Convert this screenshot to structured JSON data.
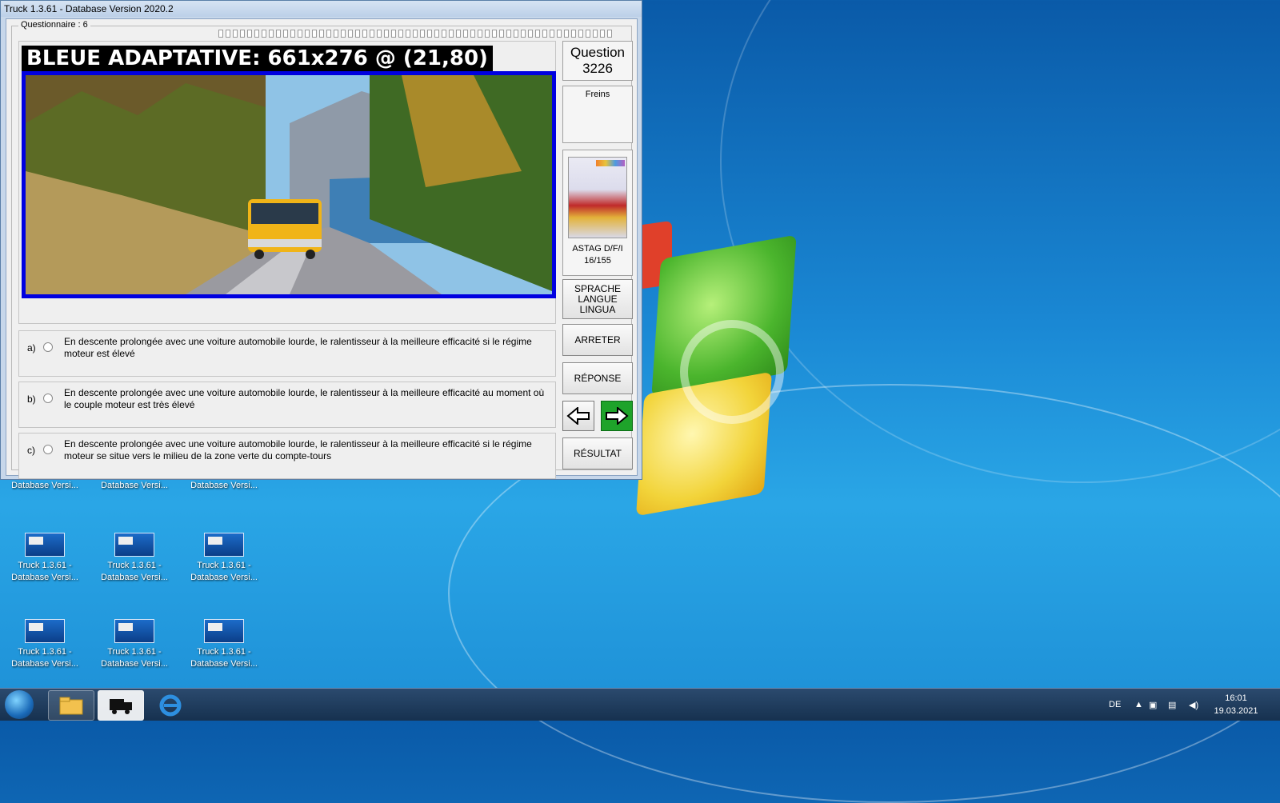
{
  "window": {
    "title": "Truck 1.3.61 - Database Version 2020.2"
  },
  "questionnaire": {
    "label": "Questionnaire : 6"
  },
  "image": {
    "caption": "BLEUE ADAPTATIVE: 661x276 @ (21,80)"
  },
  "question": {
    "label": "Question",
    "number": "3226",
    "category": "Freins"
  },
  "book": {
    "title": "ASTAG D/F/I",
    "pages": "16/155"
  },
  "buttons": {
    "language": [
      "SPRACHE",
      "LANGUE",
      "LINGUA"
    ],
    "stop": "ARRETER",
    "answer": "RÉPONSE",
    "result": "RÉSULTAT",
    "prev_icon": "arrow-left-icon",
    "next_icon": "arrow-right-icon"
  },
  "answers": [
    {
      "letter": "a)",
      "text": "En descente prolongée avec une voiture automobile lourde, le ralentisseur à la meilleure efficacité si le régime moteur est élevé"
    },
    {
      "letter": "b)",
      "text": "En descente prolongée avec une voiture automobile lourde, le ralentisseur à la meilleure efficacité au moment où le couple moteur est très élevé"
    },
    {
      "letter": "c)",
      "text": "En descente prolongée avec une voiture automobile lourde, le ralentisseur à la meilleure efficacité si le régime moteur se situe vers le milieu de la zone verte du compte-tours"
    }
  ],
  "desktop_icons": [
    {
      "line1": "",
      "line2": "Database Versi..."
    },
    {
      "line1": "",
      "line2": "Database Versi..."
    },
    {
      "line1": "",
      "line2": "Database Versi..."
    },
    {
      "line1": "Truck 1.3.61 -",
      "line2": "Database Versi..."
    },
    {
      "line1": "Truck 1.3.61 -",
      "line2": "Database Versi..."
    },
    {
      "line1": "Truck 1.3.61 -",
      "line2": "Database Versi..."
    },
    {
      "line1": "Truck 1.3.61 -",
      "line2": "Database Versi..."
    },
    {
      "line1": "Truck 1.3.61 -",
      "line2": "Database Versi..."
    },
    {
      "line1": "Truck 1.3.61 -",
      "line2": "Database Versi..."
    }
  ],
  "taskbar": {
    "language": "DE",
    "time": "16:01",
    "date": "19.03.2021"
  },
  "colors": {
    "image_border": "#0000e0",
    "next_button": "#1ea32a",
    "desktop": "#1a88d4"
  }
}
